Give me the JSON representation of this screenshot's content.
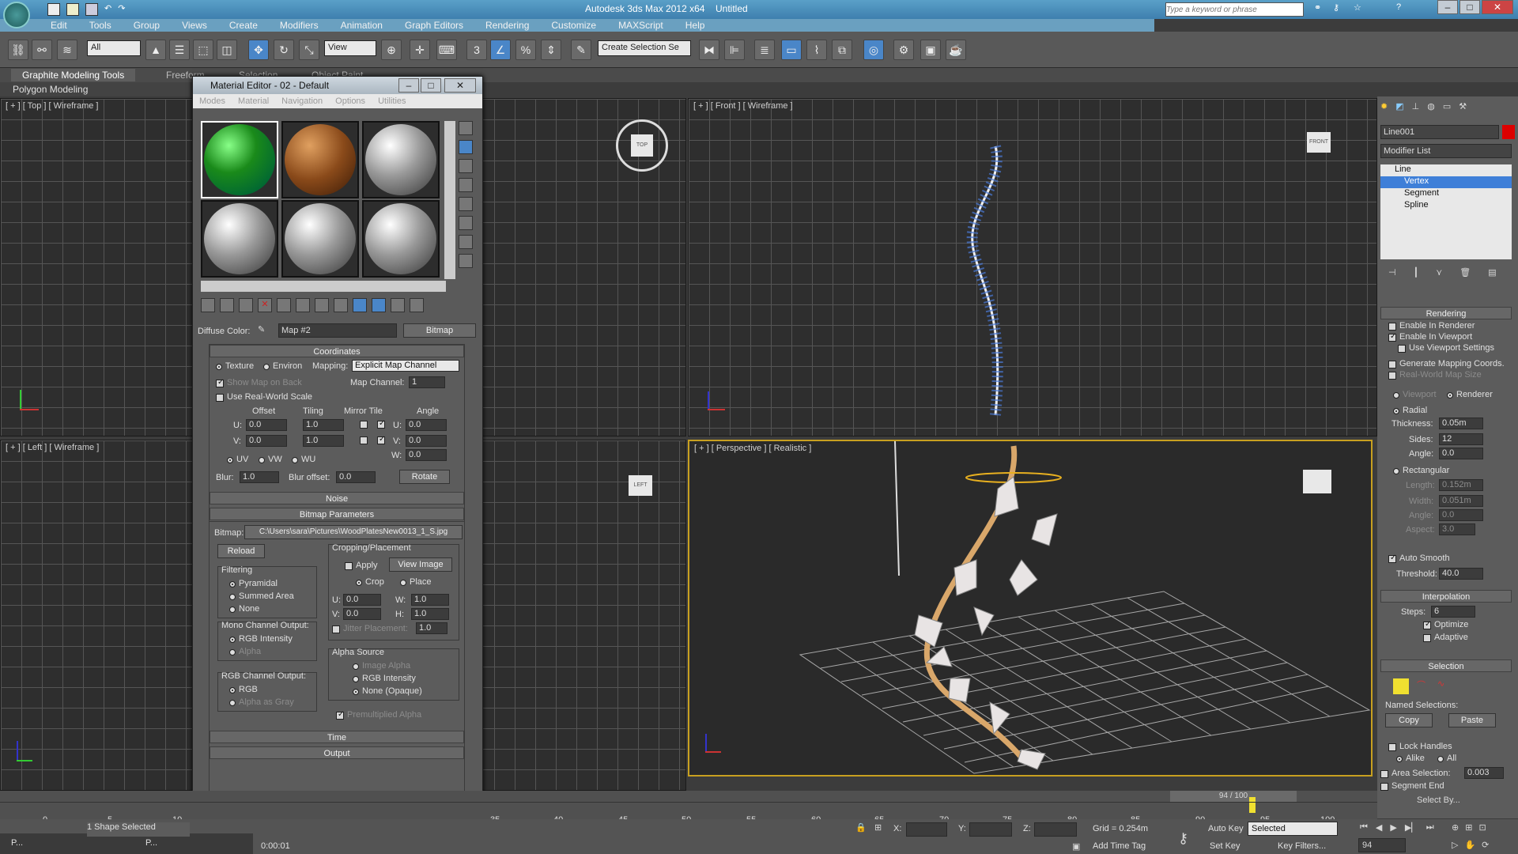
{
  "title_bar": {
    "title": "Autodesk 3ds Max 2012 x64",
    "doc": "Untitled",
    "search_placeholder": "Type a keyword or phrase"
  },
  "menu": [
    "Edit",
    "Tools",
    "Group",
    "Views",
    "Create",
    "Modifiers",
    "Animation",
    "Graph Editors",
    "Rendering",
    "Customize",
    "MAXScript",
    "Help"
  ],
  "toolbar": {
    "selection_filter": "All",
    "ref_coord": "View",
    "named_selection": "Create Selection Se"
  },
  "ribbon": {
    "tabs": [
      "Graphite Modeling Tools",
      "Freeform",
      "Selection",
      "Object Paint"
    ],
    "sub": "Polygon Modeling"
  },
  "viewports": {
    "top": "[ + ] [ Top ] [ Wireframe ]",
    "front": "[ + ] [ Front ] [ Wireframe ]",
    "left": "[ + ] [ Left ] [ Wireframe ]",
    "persp": "[ + ] [ Perspective ] [ Realistic ]"
  },
  "material_editor": {
    "title": "Material Editor - 02 - Default",
    "menus": [
      "Modes",
      "Material",
      "Navigation",
      "Options",
      "Utilities"
    ],
    "diffuse_label": "Diffuse Color:",
    "map_name": "Map #2",
    "map_type": "Bitmap",
    "coordinates": {
      "header": "Coordinates",
      "texture": "Texture",
      "environ": "Environ",
      "mapping_label": "Mapping:",
      "mapping": "Explicit Map Channel",
      "show_map": "Show Map on Back",
      "map_channel_label": "Map Channel:",
      "map_channel": "1",
      "real_world": "Use Real-World Scale",
      "offset": "Offset",
      "tiling": "Tiling",
      "mirror_tile": "Mirror Tile",
      "angle": "Angle",
      "u": "U:",
      "v": "V:",
      "w": "W:",
      "offset_u": "0.0",
      "offset_v": "0.0",
      "tiling_u": "1.0",
      "tiling_v": "1.0",
      "angle_u": "0.0",
      "angle_v": "0.0",
      "angle_w": "0.0",
      "uv": "UV",
      "vw": "VW",
      "wu": "WU",
      "blur_label": "Blur:",
      "blur": "1.0",
      "blur_offset_label": "Blur offset:",
      "blur_offset": "0.0",
      "rotate": "Rotate"
    },
    "noise": "Noise",
    "bitmap_params": {
      "header": "Bitmap Parameters",
      "bitmap_label": "Bitmap:",
      "path": "C:\\Users\\sara\\Pictures\\WoodPlatesNew0013_1_S.jpg",
      "reload": "Reload",
      "cropping": "Cropping/Placement",
      "apply": "Apply",
      "view_image": "View Image",
      "crop": "Crop",
      "place": "Place",
      "u": "0.0",
      "v": "0.0",
      "w": "1.0",
      "h": "1.0",
      "jitter": "Jitter Placement:",
      "jitter_val": "1.0",
      "filtering": "Filtering",
      "pyramidal": "Pyramidal",
      "summed_area": "Summed Area",
      "none": "None",
      "mono_out": "Mono Channel Output:",
      "rgb_intensity": "RGB Intensity",
      "alpha": "Alpha",
      "rgb_out": "RGB Channel Output:",
      "rgb": "RGB",
      "alpha_gray": "Alpha as Gray",
      "alpha_source": "Alpha Source",
      "image_alpha": "Image Alpha",
      "as_rgb_intensity": "RGB Intensity",
      "none_opaque": "None (Opaque)",
      "premult": "Premultiplied Alpha"
    },
    "time": "Time",
    "output": "Output"
  },
  "command_panel": {
    "object_name": "Line001",
    "modifier_list": "Modifier List",
    "stack": {
      "root": "Line",
      "items": [
        "Vertex",
        "Segment",
        "Spline"
      ]
    },
    "rendering": {
      "header": "Rendering",
      "enable_renderer": "Enable In Renderer",
      "enable_viewport": "Enable In Viewport",
      "use_viewport": "Use Viewport Settings",
      "gen_mapping": "Generate Mapping Coords.",
      "real_world": "Real-World Map Size",
      "viewport": "Viewport",
      "renderer": "Renderer",
      "radial": "Radial",
      "thickness_label": "Thickness:",
      "thickness": "0.05m",
      "sides_label": "Sides:",
      "sides": "12",
      "angle_label": "Angle:",
      "angle": "0.0",
      "rectangular": "Rectangular",
      "length_label": "Length:",
      "length": "0.152m",
      "width_label": "Width:",
      "width": "0.051m",
      "angle2": "0.0",
      "aspect_label": "Aspect:",
      "aspect": "3.0",
      "auto_smooth": "Auto Smooth",
      "threshold_label": "Threshold:",
      "threshold": "40.0"
    },
    "interpolation": {
      "header": "Interpolation",
      "steps_label": "Steps:",
      "steps": "6",
      "optimize": "Optimize",
      "adaptive": "Adaptive"
    },
    "selection": {
      "header": "Selection",
      "named": "Named Selections:",
      "copy": "Copy",
      "paste": "Paste",
      "lock": "Lock Handles",
      "alike": "Alike",
      "all": "All",
      "area": "Area Selection:",
      "area_val": "0.003",
      "segment_end": "Segment End",
      "select_by": "Select By..."
    }
  },
  "timeline": {
    "counter": "94 / 100",
    "ticks": [
      "0",
      "5",
      "10",
      "35",
      "40",
      "45",
      "50",
      "55",
      "60",
      "65",
      "70",
      "75",
      "80",
      "85",
      "90",
      "95",
      "100"
    ]
  },
  "status": {
    "shapes": "1 Shape Selected",
    "x_label": "X:",
    "y_label": "Y:",
    "z_label": "Z:",
    "grid": "Grid = 0.254m",
    "add_time_tag": "Add Time Tag",
    "auto_key": "Auto Key",
    "set_key": "Set Key",
    "selected": "Selected",
    "key_filters": "Key Filters...",
    "frame": "94",
    "time": "0:00:01",
    "task1": "P...",
    "task2": "P..."
  }
}
